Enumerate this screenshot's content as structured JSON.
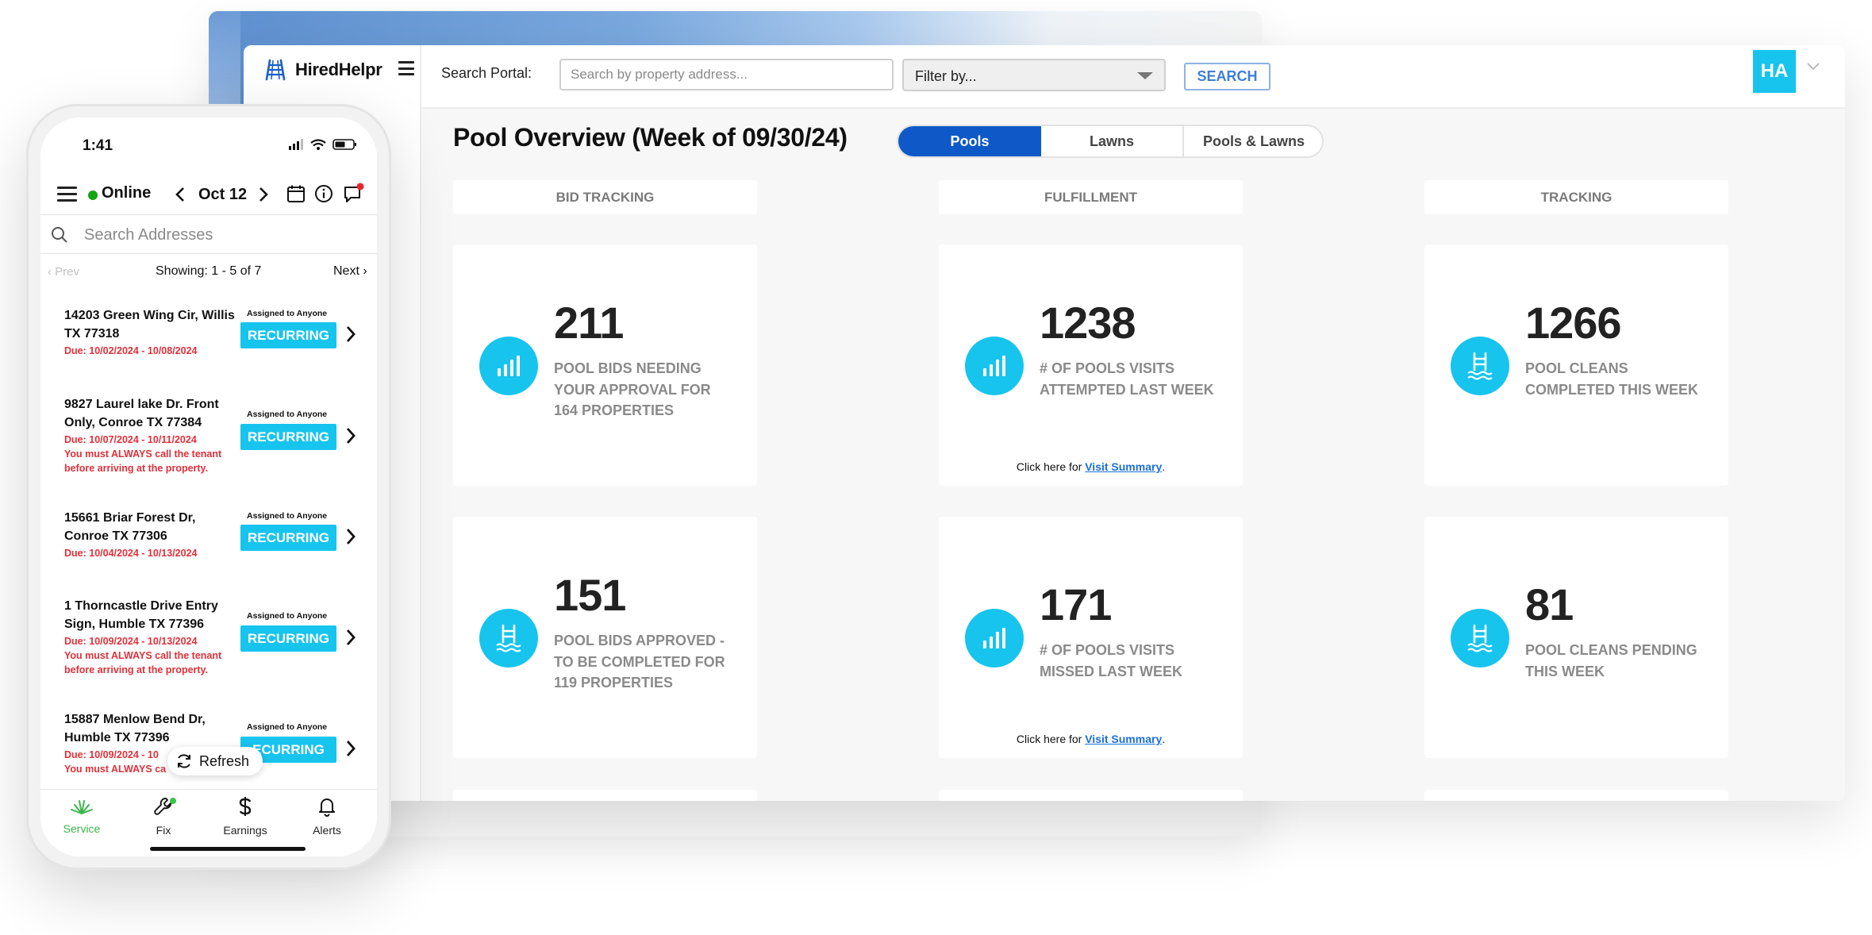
{
  "dashboard": {
    "brand": "HiredHelpr",
    "search": {
      "label": "Search Portal:",
      "placeholder": "Search by property address...",
      "filter_value": "Filter by...",
      "button": "SEARCH"
    },
    "avatar": "HA",
    "title": "Pool Overview (Week of 09/30/24)",
    "tabs": [
      "Pools",
      "Lawns",
      "Pools & Lawns"
    ],
    "active_tab": "Pools",
    "columns": [
      "BID TRACKING",
      "FULFILLMENT",
      "TRACKING"
    ],
    "cards": [
      {
        "value": "211",
        "label": "POOL BIDS NEEDING YOUR APPROVAL FOR 164 PROPERTIES",
        "icon": "signal-bars-icon"
      },
      {
        "value": "1238",
        "label": "# OF POOLS VISITS ATTEMPTED LAST WEEK",
        "icon": "signal-bars-icon",
        "link_prefix": "Click here for ",
        "link_text": "Visit Summary",
        "link_suffix": "."
      },
      {
        "value": "1266",
        "label": "POOL CLEANS COMPLETED THIS WEEK",
        "icon": "pool-ladder-icon"
      },
      {
        "value": "151",
        "label": "POOL BIDS APPROVED - TO BE COMPLETED FOR 119 PROPERTIES",
        "icon": "pool-ladder-icon"
      },
      {
        "value": "171",
        "label": "# OF POOLS VISITS MISSED LAST WEEK",
        "icon": "signal-bars-icon",
        "link_prefix": "Click here for ",
        "link_text": "Visit Summary",
        "link_suffix": "."
      },
      {
        "value": "81",
        "label": "POOL CLEANS PENDING THIS WEEK",
        "icon": "pool-ladder-icon"
      }
    ],
    "colors": {
      "accent": "#17C4EE",
      "tab_active": "#0E59C7",
      "link": "#1B6FD6"
    }
  },
  "phone": {
    "time": "1:41",
    "status": "Online",
    "date": "Oct 12",
    "search_placeholder": "Search Addresses",
    "pager": {
      "prev": "Prev",
      "showing": "Showing: 1 - 5 of 7",
      "next": "Next"
    },
    "jobs": [
      {
        "address": "14203 Green Wing Cir, Willis TX 77318",
        "due": "Due: 10/02/2024 - 10/08/2024",
        "note": "",
        "assigned": "Assigned to Anyone",
        "badge": "RECURRING"
      },
      {
        "address": "9827 Laurel lake Dr. Front Only, Conroe TX 77384",
        "due": "Due: 10/07/2024 - 10/11/2024",
        "note": "You must ALWAYS call the tenant before arriving at the property.",
        "assigned": "Assigned to Anyone",
        "badge": "RECURRING"
      },
      {
        "address": "15661 Briar Forest Dr, Conroe TX 77306",
        "due": "Due: 10/04/2024 - 10/13/2024",
        "note": "",
        "assigned": "Assigned to Anyone",
        "badge": "RECURRING"
      },
      {
        "address": "1 Thorncastle Drive Entry Sign, Humble TX 77396",
        "due": "Due: 10/09/2024 - 10/13/2024",
        "note": "You must ALWAYS call the tenant before arriving at the property.",
        "assigned": "Assigned to Anyone",
        "badge": "RECURRING"
      },
      {
        "address": "15887 Menlow Bend Dr, Humble TX 77396",
        "due": "Due: 10/09/2024 - 10",
        "note": "You must ALWAYS ca",
        "assigned": "Assigned to Anyone",
        "badge": "ECURRING"
      }
    ],
    "refresh": "Refresh",
    "nav": [
      "Service",
      "Fix",
      "Earnings",
      "Alerts"
    ],
    "colors": {
      "online": "#16A316",
      "due": "#E0303A",
      "active_nav": "#39B54A"
    }
  }
}
